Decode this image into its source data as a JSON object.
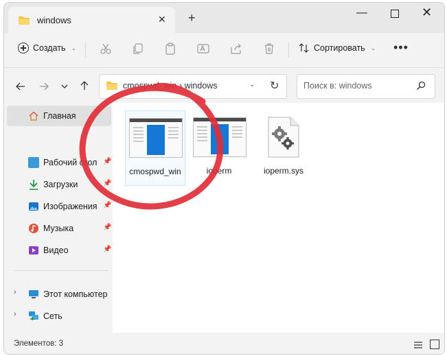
{
  "window": {
    "tab_title": "windows",
    "tab_close": "✕",
    "new_tab": "+"
  },
  "toolbar": {
    "create_label": "Создать",
    "sort_label": "Сортировать",
    "more_label": "•••"
  },
  "address": {
    "path_text": "cmospwd_win › windows",
    "search_placeholder": "Поиск в: windows"
  },
  "sidebar": {
    "home": "Главная",
    "quick_access": [
      {
        "label": "Рабочий стол",
        "icon": "desktop-icon",
        "color": "#3a9ad9"
      },
      {
        "label": "Загрузки",
        "icon": "downloads-icon",
        "color": "#1e8e3e"
      },
      {
        "label": "Изображения",
        "icon": "pictures-icon",
        "color": "#1a73c8"
      },
      {
        "label": "Музыка",
        "icon": "music-icon",
        "color": "#e0533f"
      },
      {
        "label": "Видео",
        "icon": "videos-icon",
        "color": "#8b3fc7"
      }
    ],
    "this_pc": "Этот компьютер",
    "network": "Сеть"
  },
  "files": [
    {
      "name": "cmospwd_win",
      "type": "application",
      "selected": true
    },
    {
      "name": "ioperm",
      "type": "application",
      "selected": false
    },
    {
      "name": "ioperm.sys",
      "type": "system",
      "selected": false
    }
  ],
  "status": {
    "items_count": "Элементов: 3"
  },
  "colors": {
    "accent": "#1577d6",
    "annotation": "#e02f3a",
    "folder": "#f5c242"
  }
}
